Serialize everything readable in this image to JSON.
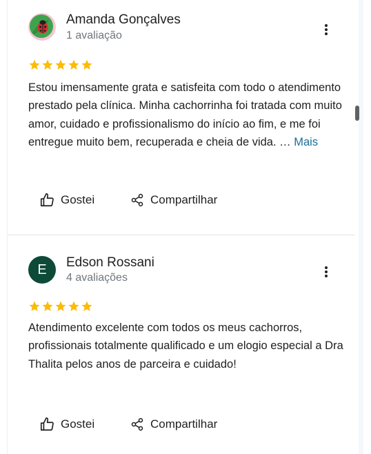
{
  "reviews": [
    {
      "name": "Amanda Gonçalves",
      "count": "1 avaliação",
      "rating": 5,
      "text": "Estou imensamente grata e satisfeita com todo o atendimento prestado pela clínica. Minha cachorrinha foi tratada com muito amor, cuidado e profissionalismo do início ao fim, e me foi entregue muito bem, recuperada e cheia de vida. …",
      "more_label": "Mais",
      "like_label": "Gostei",
      "share_label": "Compartilhar",
      "avatar_icon": "ladybug-icon"
    },
    {
      "name": "Edson Rossani",
      "count": "4 avaliações",
      "rating": 5,
      "avatar_letter": "E",
      "avatar_color": "#0d4a37",
      "text": "Atendimento excelente com todos os meus cachorros, profissionais totalmente qualificado e um elogio especial a Dra Thalita pelos anos de parceira e cuidado!",
      "like_label": "Gostei",
      "share_label": "Compartilhar"
    }
  ],
  "colors": {
    "star": "#fbbc04",
    "link": "#1a6e97",
    "avatar_green": "#0d4a37"
  }
}
